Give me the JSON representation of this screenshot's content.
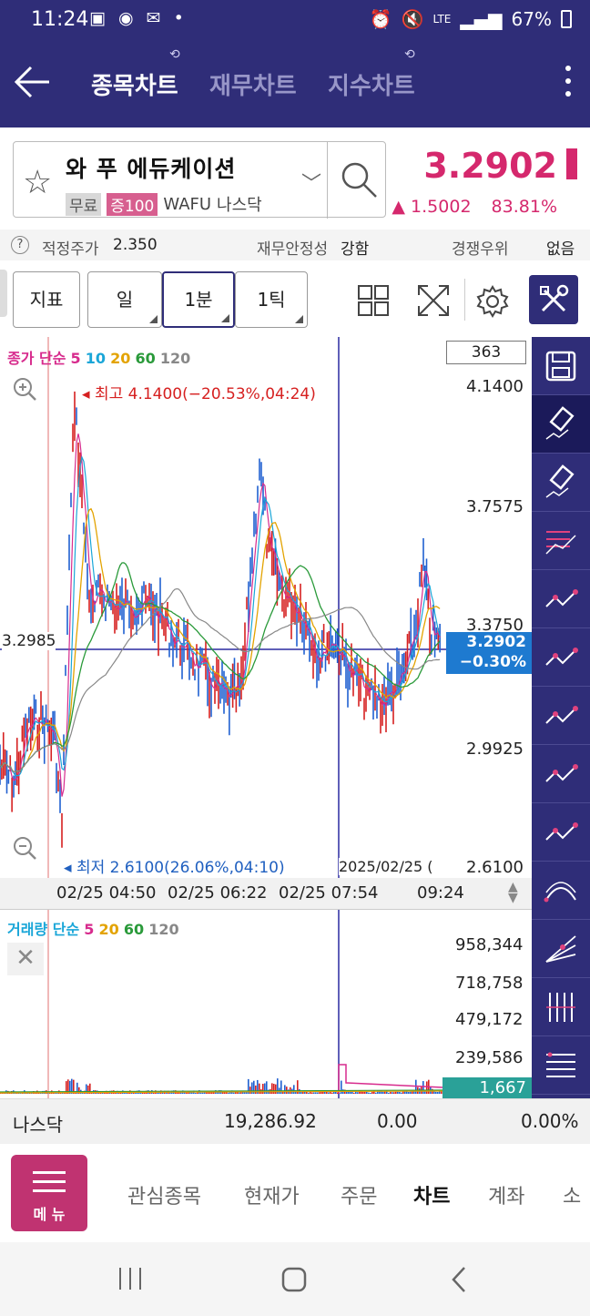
{
  "status": {
    "time": "11:24",
    "battery": "67%",
    "signal_label": "LTE"
  },
  "header": {
    "tabs": [
      {
        "label": "종목차트",
        "active": true
      },
      {
        "label": "재무차트",
        "active": false
      },
      {
        "label": "지수차트",
        "active": false
      }
    ]
  },
  "stock": {
    "name": "와 푸 에듀케이션",
    "tag_free": "무료",
    "tag_margin": "증100",
    "ticker": "WAFU",
    "market": "나스닥",
    "price": "3.2902",
    "change_abs": "▲ 1.5002",
    "change_pct": "83.81%"
  },
  "info": {
    "fair_price_label": "적정주가",
    "fair_price_value": "2.350",
    "fin_stability_label": "재무안정성",
    "fin_stability_value": "강함",
    "competitive_label": "경쟁우위",
    "competitive_value": "없음"
  },
  "toolbar": {
    "indicator_label": "지표",
    "period_day": "일",
    "period_minute": "1분",
    "period_tick": "1틱"
  },
  "chart": {
    "count_box": "363",
    "ma_title": "종가 단순",
    "ma_periods": [
      {
        "label": "5",
        "color": "#d72b8d"
      },
      {
        "label": "10",
        "color": "#1aa6d8"
      },
      {
        "label": "20",
        "color": "#e3a300"
      },
      {
        "label": "60",
        "color": "#2a9a3a"
      },
      {
        "label": "120",
        "color": "#888888"
      }
    ],
    "high_label": "최고 4.1400(−20.53%,04:24)",
    "low_label": "최저 2.6100(26.06%,04:10)",
    "y_ticks": [
      "4.1400",
      "3.7575",
      "3.3750",
      "2.9925",
      "2.6100"
    ],
    "crosshair_value": "3.2985",
    "current_price": "3.2902",
    "current_change": "−0.30%",
    "date_label": "2025/02/25 (",
    "time_ticks": [
      "02/25 04:50",
      "02/25 06:22",
      "02/25 07:54",
      "09:24"
    ]
  },
  "volume": {
    "title": "거래량 단순",
    "ma_periods": [
      {
        "label": "5",
        "color": "#d72b8d"
      },
      {
        "label": "20",
        "color": "#e3a300"
      },
      {
        "label": "60",
        "color": "#2a9a3a"
      },
      {
        "label": "120",
        "color": "#888888"
      }
    ],
    "y_ticks": [
      "958,344",
      "718,758",
      "479,172",
      "239,586"
    ],
    "current": "1,667"
  },
  "index_row": {
    "name": "나스닥",
    "value": "19,286.92",
    "change": "0.00",
    "pct": "0.00%"
  },
  "nav": {
    "menu_label": "메 뉴",
    "items": [
      {
        "label": "관심종목",
        "active": false
      },
      {
        "label": "현재가",
        "active": false
      },
      {
        "label": "주문",
        "active": false
      },
      {
        "label": "차트",
        "active": true
      },
      {
        "label": "계좌",
        "active": false
      },
      {
        "label": "소",
        "active": false
      }
    ]
  },
  "sidebar_tools": [
    "save-icon",
    "eraser-icon",
    "eraser-all-icon",
    "hcl-lines-icon",
    "crosshair-point-icon",
    "triangle-point-icon",
    "zigzag-icon",
    "trendline-icon",
    "auto-trend-icon",
    "arc-icon",
    "fan-icon",
    "vertical-lines-icon",
    "horizontal-lines-icon"
  ]
}
